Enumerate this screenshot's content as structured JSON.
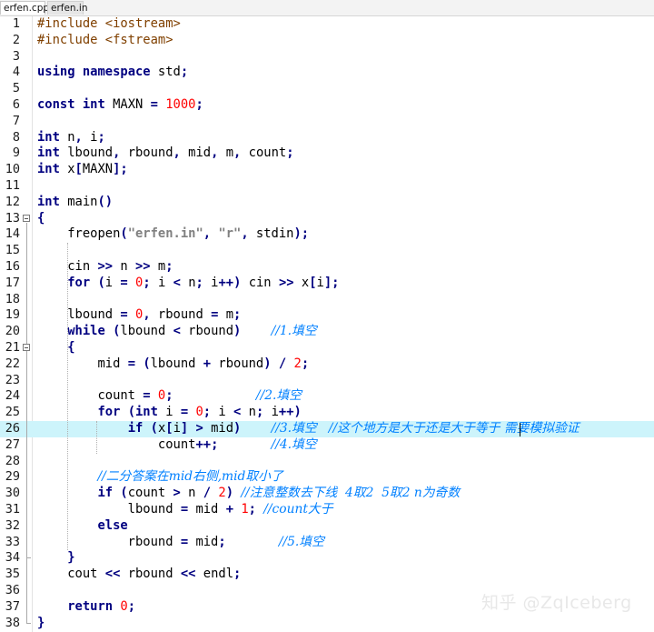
{
  "editor": {
    "tabs": [
      {
        "label": "erfen.cpp",
        "active": true
      },
      {
        "label": "erfen.in",
        "active": false
      }
    ],
    "highlighted_line": 26,
    "lines": [
      {
        "n": "1",
        "tokens": [
          [
            "pp",
            "#include <iostream>"
          ]
        ]
      },
      {
        "n": "2",
        "tokens": [
          [
            "pp",
            "#include <fstream>"
          ]
        ]
      },
      {
        "n": "3",
        "tokens": []
      },
      {
        "n": "4",
        "tokens": [
          [
            "kw",
            "using"
          ],
          [
            "t",
            " "
          ],
          [
            "kw",
            "namespace"
          ],
          [
            "t",
            " std"
          ],
          [
            "op",
            ";"
          ]
        ]
      },
      {
        "n": "5",
        "tokens": []
      },
      {
        "n": "6",
        "tokens": [
          [
            "kw",
            "const"
          ],
          [
            "t",
            " "
          ],
          [
            "kw",
            "int"
          ],
          [
            "t",
            " MAXN "
          ],
          [
            "op",
            "="
          ],
          [
            "t",
            " "
          ],
          [
            "num",
            "1000"
          ],
          [
            "op",
            ";"
          ]
        ]
      },
      {
        "n": "7",
        "tokens": []
      },
      {
        "n": "8",
        "tokens": [
          [
            "kw",
            "int"
          ],
          [
            "t",
            " n"
          ],
          [
            "op",
            ","
          ],
          [
            "t",
            " i"
          ],
          [
            "op",
            ";"
          ]
        ]
      },
      {
        "n": "9",
        "tokens": [
          [
            "kw",
            "int"
          ],
          [
            "t",
            " lbound"
          ],
          [
            "op",
            ","
          ],
          [
            "t",
            " rbound"
          ],
          [
            "op",
            ","
          ],
          [
            "t",
            " mid"
          ],
          [
            "op",
            ","
          ],
          [
            "t",
            " m"
          ],
          [
            "op",
            ","
          ],
          [
            "t",
            " count"
          ],
          [
            "op",
            ";"
          ]
        ]
      },
      {
        "n": "10",
        "tokens": [
          [
            "kw",
            "int"
          ],
          [
            "t",
            " x"
          ],
          [
            "op",
            "["
          ],
          [
            "t",
            "MAXN"
          ],
          [
            "op",
            "]"
          ],
          [
            "op",
            ";"
          ]
        ]
      },
      {
        "n": "11",
        "tokens": []
      },
      {
        "n": "12",
        "tokens": [
          [
            "kw",
            "int"
          ],
          [
            "t",
            " main"
          ],
          [
            "op",
            "()"
          ]
        ]
      },
      {
        "n": "13",
        "tokens": [
          [
            "op",
            "{"
          ]
        ]
      },
      {
        "n": "14",
        "tokens": [
          [
            "t",
            "    freopen"
          ],
          [
            "op",
            "("
          ],
          [
            "str",
            "\"erfen.in\""
          ],
          [
            "op",
            ","
          ],
          [
            "t",
            " "
          ],
          [
            "str",
            "\"r\""
          ],
          [
            "op",
            ","
          ],
          [
            "t",
            " stdin"
          ],
          [
            "op",
            ")"
          ],
          [
            "op",
            ";"
          ]
        ]
      },
      {
        "n": "15",
        "tokens": []
      },
      {
        "n": "16",
        "tokens": [
          [
            "t",
            "    cin "
          ],
          [
            "op",
            ">>"
          ],
          [
            "t",
            " n "
          ],
          [
            "op",
            ">>"
          ],
          [
            "t",
            " m"
          ],
          [
            "op",
            ";"
          ]
        ]
      },
      {
        "n": "17",
        "tokens": [
          [
            "t",
            "    "
          ],
          [
            "kw",
            "for"
          ],
          [
            "t",
            " "
          ],
          [
            "op",
            "("
          ],
          [
            "t",
            "i "
          ],
          [
            "op",
            "="
          ],
          [
            "t",
            " "
          ],
          [
            "num",
            "0"
          ],
          [
            "op",
            ";"
          ],
          [
            "t",
            " i "
          ],
          [
            "op",
            "<"
          ],
          [
            "t",
            " n"
          ],
          [
            "op",
            ";"
          ],
          [
            "t",
            " i"
          ],
          [
            "op",
            "++"
          ],
          [
            "op",
            ")"
          ],
          [
            "t",
            " cin "
          ],
          [
            "op",
            ">>"
          ],
          [
            "t",
            " x"
          ],
          [
            "op",
            "["
          ],
          [
            "t",
            "i"
          ],
          [
            "op",
            "]"
          ],
          [
            "op",
            ";"
          ]
        ]
      },
      {
        "n": "18",
        "tokens": []
      },
      {
        "n": "19",
        "tokens": [
          [
            "t",
            "    lbound "
          ],
          [
            "op",
            "="
          ],
          [
            "t",
            " "
          ],
          [
            "num",
            "0"
          ],
          [
            "op",
            ","
          ],
          [
            "t",
            " rbound "
          ],
          [
            "op",
            "="
          ],
          [
            "t",
            " m"
          ],
          [
            "op",
            ";"
          ]
        ]
      },
      {
        "n": "20",
        "tokens": [
          [
            "t",
            "    "
          ],
          [
            "kw",
            "while"
          ],
          [
            "t",
            " "
          ],
          [
            "op",
            "("
          ],
          [
            "t",
            "lbound "
          ],
          [
            "op",
            "<"
          ],
          [
            "t",
            " rbound"
          ],
          [
            "op",
            ")"
          ],
          [
            "t",
            "    "
          ],
          [
            "ccom",
            "//1.填空"
          ]
        ]
      },
      {
        "n": "21",
        "tokens": [
          [
            "t",
            "    "
          ],
          [
            "op",
            "{"
          ]
        ]
      },
      {
        "n": "22",
        "tokens": [
          [
            "t",
            "        mid "
          ],
          [
            "op",
            "="
          ],
          [
            "t",
            " "
          ],
          [
            "op",
            "("
          ],
          [
            "t",
            "lbound "
          ],
          [
            "op",
            "+"
          ],
          [
            "t",
            " rbound"
          ],
          [
            "op",
            ")"
          ],
          [
            "t",
            " "
          ],
          [
            "op",
            "/"
          ],
          [
            "t",
            " "
          ],
          [
            "num",
            "2"
          ],
          [
            "op",
            ";"
          ]
        ]
      },
      {
        "n": "23",
        "tokens": []
      },
      {
        "n": "24",
        "tokens": [
          [
            "t",
            "        count "
          ],
          [
            "op",
            "="
          ],
          [
            "t",
            " "
          ],
          [
            "num",
            "0"
          ],
          [
            "op",
            ";"
          ],
          [
            "t",
            "           "
          ],
          [
            "ccom",
            "//2.填空"
          ]
        ]
      },
      {
        "n": "25",
        "tokens": [
          [
            "t",
            "        "
          ],
          [
            "kw",
            "for"
          ],
          [
            "t",
            " "
          ],
          [
            "op",
            "("
          ],
          [
            "kw",
            "int"
          ],
          [
            "t",
            " i "
          ],
          [
            "op",
            "="
          ],
          [
            "t",
            " "
          ],
          [
            "num",
            "0"
          ],
          [
            "op",
            ";"
          ],
          [
            "t",
            " i "
          ],
          [
            "op",
            "<"
          ],
          [
            "t",
            " n"
          ],
          [
            "op",
            ";"
          ],
          [
            "t",
            " i"
          ],
          [
            "op",
            "++"
          ],
          [
            "op",
            ")"
          ]
        ]
      },
      {
        "n": "26",
        "tokens": [
          [
            "t",
            "            "
          ],
          [
            "kw",
            "if"
          ],
          [
            "t",
            " "
          ],
          [
            "op",
            "("
          ],
          [
            "t",
            "x"
          ],
          [
            "op",
            "["
          ],
          [
            "t",
            "i"
          ],
          [
            "op",
            "]"
          ],
          [
            "t",
            " "
          ],
          [
            "op",
            ">"
          ],
          [
            "t",
            " mid"
          ],
          [
            "op",
            ")"
          ],
          [
            "t",
            "    "
          ],
          [
            "ccom",
            "//3.填空   //这个地方是大于还是大于等于 需要模拟验证"
          ]
        ]
      },
      {
        "n": "27",
        "tokens": [
          [
            "t",
            "                count"
          ],
          [
            "op",
            "++"
          ],
          [
            "op",
            ";"
          ],
          [
            "t",
            "       "
          ],
          [
            "ccom",
            "//4.填空"
          ]
        ]
      },
      {
        "n": "28",
        "tokens": []
      },
      {
        "n": "29",
        "tokens": [
          [
            "t",
            "        "
          ],
          [
            "ccom",
            "//二分答案在mid右侧,mid取小了"
          ]
        ]
      },
      {
        "n": "30",
        "tokens": [
          [
            "t",
            "        "
          ],
          [
            "kw",
            "if"
          ],
          [
            "t",
            " "
          ],
          [
            "op",
            "("
          ],
          [
            "t",
            "count "
          ],
          [
            "op",
            ">"
          ],
          [
            "t",
            " n "
          ],
          [
            "op",
            "/"
          ],
          [
            "t",
            " "
          ],
          [
            "num",
            "2"
          ],
          [
            "op",
            ")"
          ],
          [
            "t",
            " "
          ],
          [
            "ccom",
            "//注意整数去下线  4取2  5取2 n为奇数"
          ]
        ]
      },
      {
        "n": "31",
        "tokens": [
          [
            "t",
            "            lbound "
          ],
          [
            "op",
            "="
          ],
          [
            "t",
            " mid "
          ],
          [
            "op",
            "+"
          ],
          [
            "t",
            " "
          ],
          [
            "num",
            "1"
          ],
          [
            "op",
            ";"
          ],
          [
            "t",
            " "
          ],
          [
            "ccom",
            "//count大于"
          ]
        ]
      },
      {
        "n": "32",
        "tokens": [
          [
            "t",
            "        "
          ],
          [
            "kw",
            "else"
          ]
        ]
      },
      {
        "n": "33",
        "tokens": [
          [
            "t",
            "            rbound "
          ],
          [
            "op",
            "="
          ],
          [
            "t",
            " mid"
          ],
          [
            "op",
            ";"
          ],
          [
            "t",
            "       "
          ],
          [
            "ccom",
            "//5.填空"
          ]
        ]
      },
      {
        "n": "34",
        "tokens": [
          [
            "t",
            "    "
          ],
          [
            "op",
            "}"
          ]
        ]
      },
      {
        "n": "35",
        "tokens": [
          [
            "t",
            "    cout "
          ],
          [
            "op",
            "<<"
          ],
          [
            "t",
            " rbound "
          ],
          [
            "op",
            "<<"
          ],
          [
            "t",
            " endl"
          ],
          [
            "op",
            ";"
          ]
        ]
      },
      {
        "n": "36",
        "tokens": []
      },
      {
        "n": "37",
        "tokens": [
          [
            "t",
            "    "
          ],
          [
            "kw",
            "return"
          ],
          [
            "t",
            " "
          ],
          [
            "num",
            "0"
          ],
          [
            "op",
            ";"
          ]
        ]
      },
      {
        "n": "38",
        "tokens": [
          [
            "op",
            "}"
          ]
        ]
      }
    ]
  },
  "watermark": "知乎 @ZqIceberg"
}
